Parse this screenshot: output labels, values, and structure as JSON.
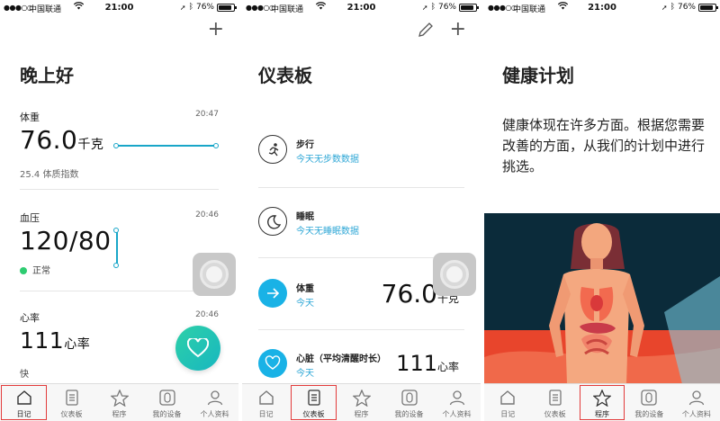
{
  "status": {
    "carrier": "中国联通",
    "time": "21:00",
    "battery": "76%",
    "battery_level": 0.76
  },
  "tabs": [
    "日记",
    "仪表板",
    "程序",
    "我的设备",
    "个人资料"
  ],
  "diary": {
    "title": "晚上好",
    "weight": {
      "label": "体重",
      "time": "20:47",
      "value": "76.0",
      "unit": "千克",
      "sub": "25.4 体质指数"
    },
    "bp": {
      "label": "血压",
      "time": "20:46",
      "value": "120/80",
      "status": "正常"
    },
    "hr": {
      "label": "心率",
      "time": "20:46",
      "value": "111",
      "unit": "心率",
      "status": "快"
    }
  },
  "dashboard": {
    "title": "仪表板",
    "walk": {
      "title": "步行",
      "desc": "今天无步数数据"
    },
    "sleep": {
      "title": "睡眠",
      "desc": "今天无睡眠数据"
    },
    "weight": {
      "title": "体重",
      "desc": "今天",
      "value": "76.0",
      "unit": "千克"
    },
    "heart": {
      "title": "心脏（平均清醒时长）",
      "desc": "今天",
      "value": "111",
      "unit": "心率"
    }
  },
  "plan": {
    "title": "健康计划",
    "text": "健康体现在许多方面。根据您需要改善的方面，从我们的计划中进行挑选。"
  },
  "colors": {
    "accent": "#19a6c8",
    "highlight": "#e23b3b",
    "fab": "#2dd0a8"
  }
}
